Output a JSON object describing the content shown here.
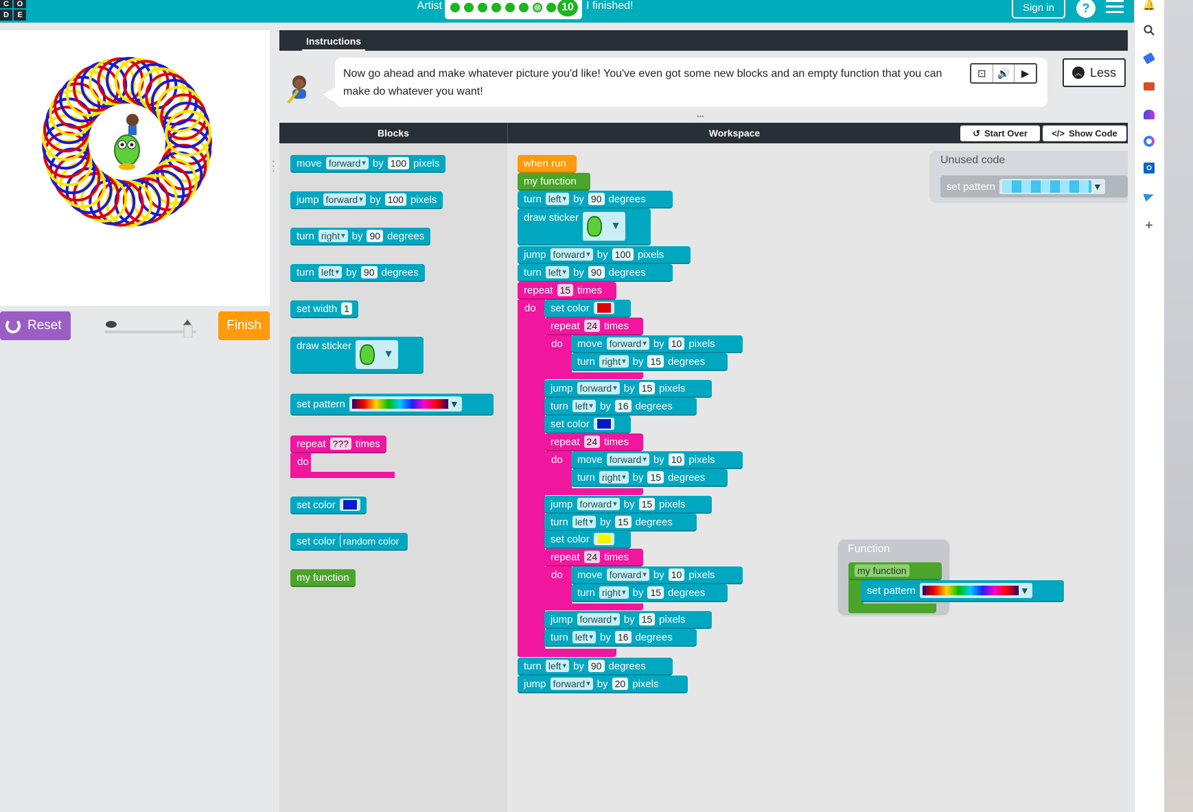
{
  "header": {
    "logo_letters": [
      "C",
      "O",
      "D",
      "E"
    ],
    "level_title": "Artist",
    "level_number": "10",
    "progress_dots": [
      "done",
      "done",
      "done",
      "done",
      "done",
      "done",
      "open",
      "done",
      "done"
    ],
    "finished_link": "I finished!",
    "sign_in": "Sign in",
    "help": "?"
  },
  "browser_sidebar": {
    "icons": [
      "bell-icon",
      "search-icon",
      "tag-icon",
      "toolbox-icon",
      "people-icon",
      "copilot-icon",
      "outlook-icon",
      "send-icon",
      "plus-icon"
    ]
  },
  "controls": {
    "reset": "Reset",
    "finish": "Finish"
  },
  "instructions": {
    "tab": "Instructions",
    "text": "Now go ahead and make whatever picture you'd like! You've even got some new blocks and an empty function that you can make do whatever you want!",
    "less": "Less"
  },
  "panels": {
    "blocks_title": "Blocks",
    "workspace_title": "Workspace",
    "start_over": "Start Over",
    "show_code": "Show Code",
    "unused_title": "Unused code",
    "function_title": "Function"
  },
  "words": {
    "by": "by",
    "pixels": "pixels",
    "degrees": "degrees",
    "times": "times",
    "do": "do"
  },
  "toolbox": {
    "move_label": "move",
    "move_dir": "forward",
    "move_val": "100",
    "jump_label": "jump",
    "jump_dir": "forward",
    "jump_val": "100",
    "turn1_label": "turn",
    "turn1_dir": "right",
    "turn1_val": "90",
    "turn2_label": "turn",
    "turn2_dir": "left",
    "turn2_val": "90",
    "set_width": "set width",
    "width_val": "1",
    "draw_sticker": "draw sticker",
    "set_pattern": "set pattern",
    "repeat": "repeat",
    "repeat_val": "???",
    "set_color": "set color",
    "set_color_blue": "#0a1ccd",
    "random_color": "random color",
    "my_function": "my function"
  },
  "workspace": {
    "when_run": "when run",
    "my_function": "my function",
    "turn_left_1": {
      "label": "turn",
      "dir": "left",
      "val": "90"
    },
    "draw_sticker": "draw sticker",
    "jump_1": {
      "label": "jump",
      "dir": "forward",
      "val": "100"
    },
    "turn_left_2": {
      "label": "turn",
      "dir": "left",
      "val": "90"
    },
    "outer_repeat": {
      "label": "repeat",
      "val": "15"
    },
    "set_color_label": "set color",
    "colors": [
      "#e00000",
      "#0018c8",
      "#f5f500"
    ],
    "inner_repeat_val": "24",
    "move_dir": "forward",
    "move_val": "10",
    "turn_dir": "right",
    "turn_val": "15",
    "jump_inner_val": "15",
    "left_vals": [
      "16",
      "15",
      "16"
    ],
    "final_turn": {
      "label": "turn",
      "dir": "left",
      "val": "90"
    },
    "final_jump": {
      "label": "jump",
      "dir": "forward",
      "val": "20"
    },
    "unused_set_pattern": "set pattern",
    "func_my_function": "my function",
    "func_set_pattern": "set pattern"
  }
}
